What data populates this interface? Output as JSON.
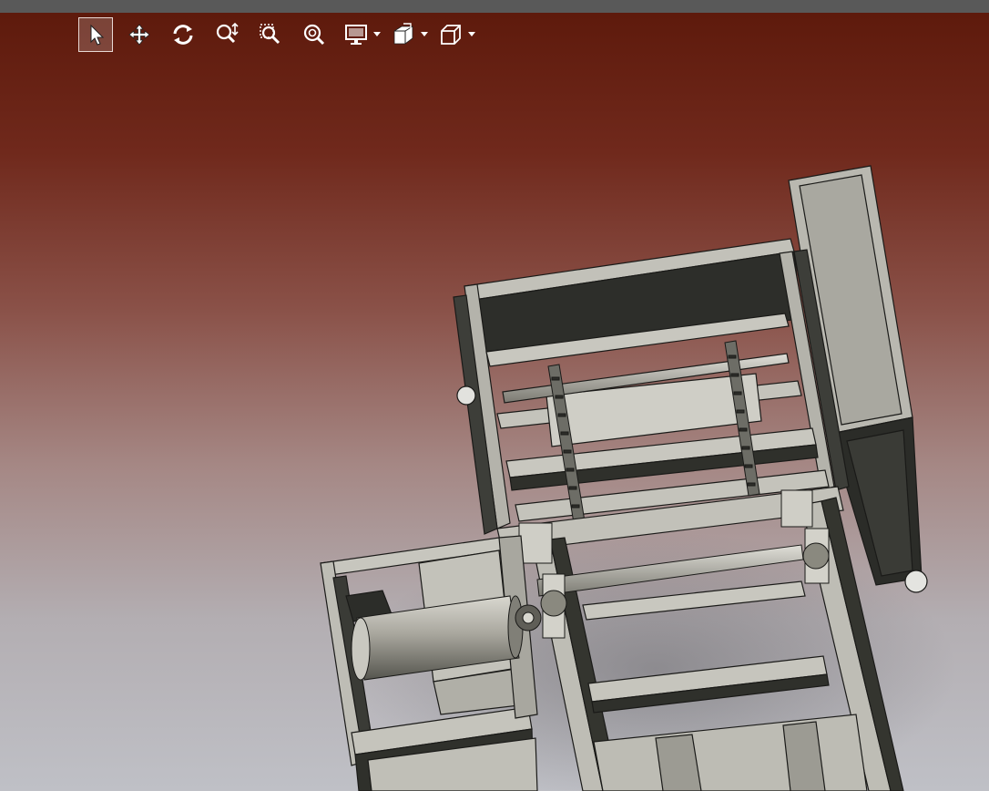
{
  "window": {
    "titlebar_color": "#595959"
  },
  "viewport": {
    "background_top": "#5e1a0c",
    "background_bottom": "#bfc0c6",
    "model_color": "#b8b6ae",
    "model_dark": "#2f302b"
  },
  "toolbar": {
    "items": [
      {
        "icon": "select-arrow-icon",
        "active": true
      },
      {
        "icon": "pan-icon",
        "active": false
      },
      {
        "icon": "rotate-icon",
        "active": false
      },
      {
        "icon": "zoom-in-out-icon",
        "active": false
      },
      {
        "icon": "zoom-to-area-icon",
        "active": false
      },
      {
        "icon": "zoom-to-fit-icon",
        "active": false
      },
      {
        "icon": "display-style-icon",
        "dropdown": true
      },
      {
        "icon": "section-view-icon",
        "dropdown": true
      },
      {
        "icon": "view-orientation-cube-icon",
        "dropdown": true
      }
    ]
  }
}
